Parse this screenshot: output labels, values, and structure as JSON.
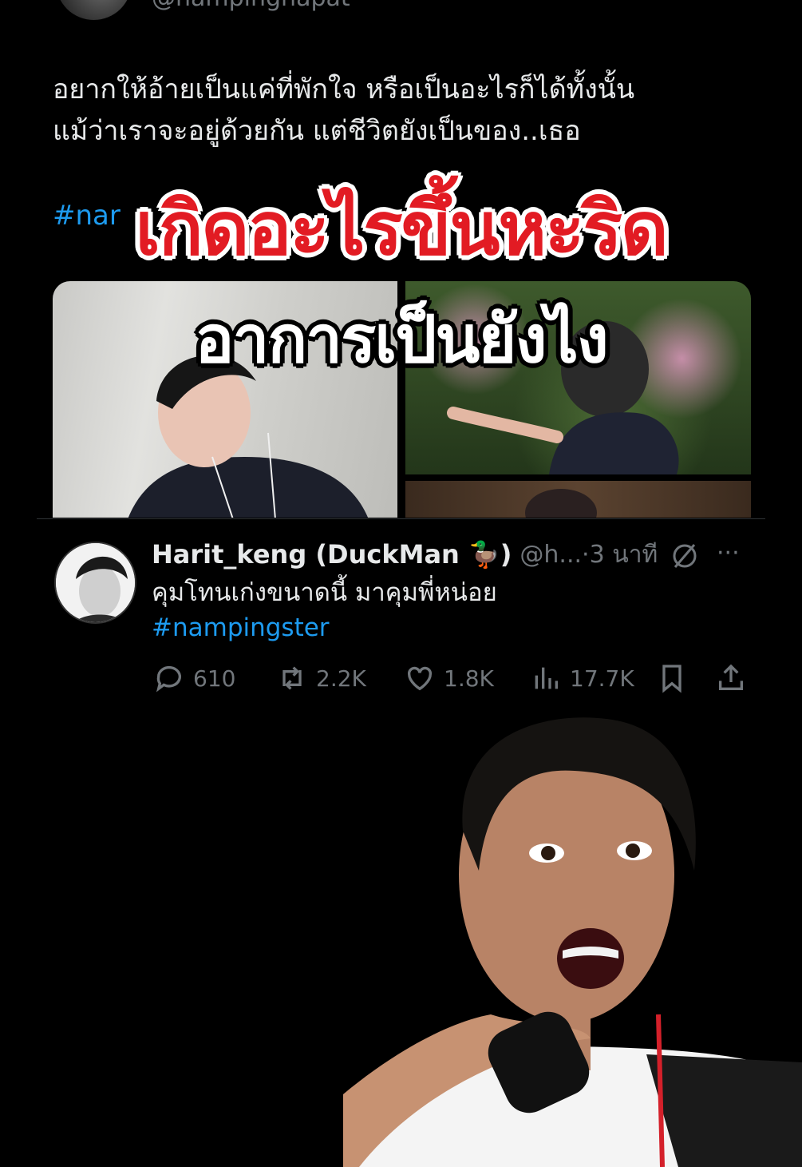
{
  "top": {
    "handle": "@nampinghapat"
  },
  "quote": {
    "text_line1": "อยากให้อ้ายเป็นแค่ที่พักใจ หรือเป็นอะไรก็ได้ทั้งนั้น",
    "text_line2": "แม้ว่าเราจะอยู่ด้วยกัน แต่ชีวิตยังเป็นของ..เธอ",
    "hashtag_visible": "#nar"
  },
  "overlay": {
    "headline_1": "เกิดอะไรขึ้นหะริด",
    "headline_2": "อาการเป็นยังไง"
  },
  "tweet": {
    "display_name": "Harit_keng (DuckMan 🦆)",
    "handle_meta": "@h...·3 นาที",
    "text": "คุมโทนเก่งขนาดนี้ มาคุมพี่หน่อย",
    "hashtag": "#nampingster",
    "more": "···"
  },
  "actions": {
    "replies": "610",
    "retweets": "2.2K",
    "likes": "1.8K",
    "views": "17.7K"
  },
  "colors": {
    "background": "#000000",
    "text": "#e7e9ea",
    "muted": "#71767b",
    "link": "#1d9bf0",
    "headline_red": "#e21b23"
  },
  "icons": [
    "reply-icon",
    "retweet-icon",
    "like-icon",
    "views-icon",
    "bookmark-icon",
    "share-icon",
    "grok-icon",
    "more-icon"
  ]
}
